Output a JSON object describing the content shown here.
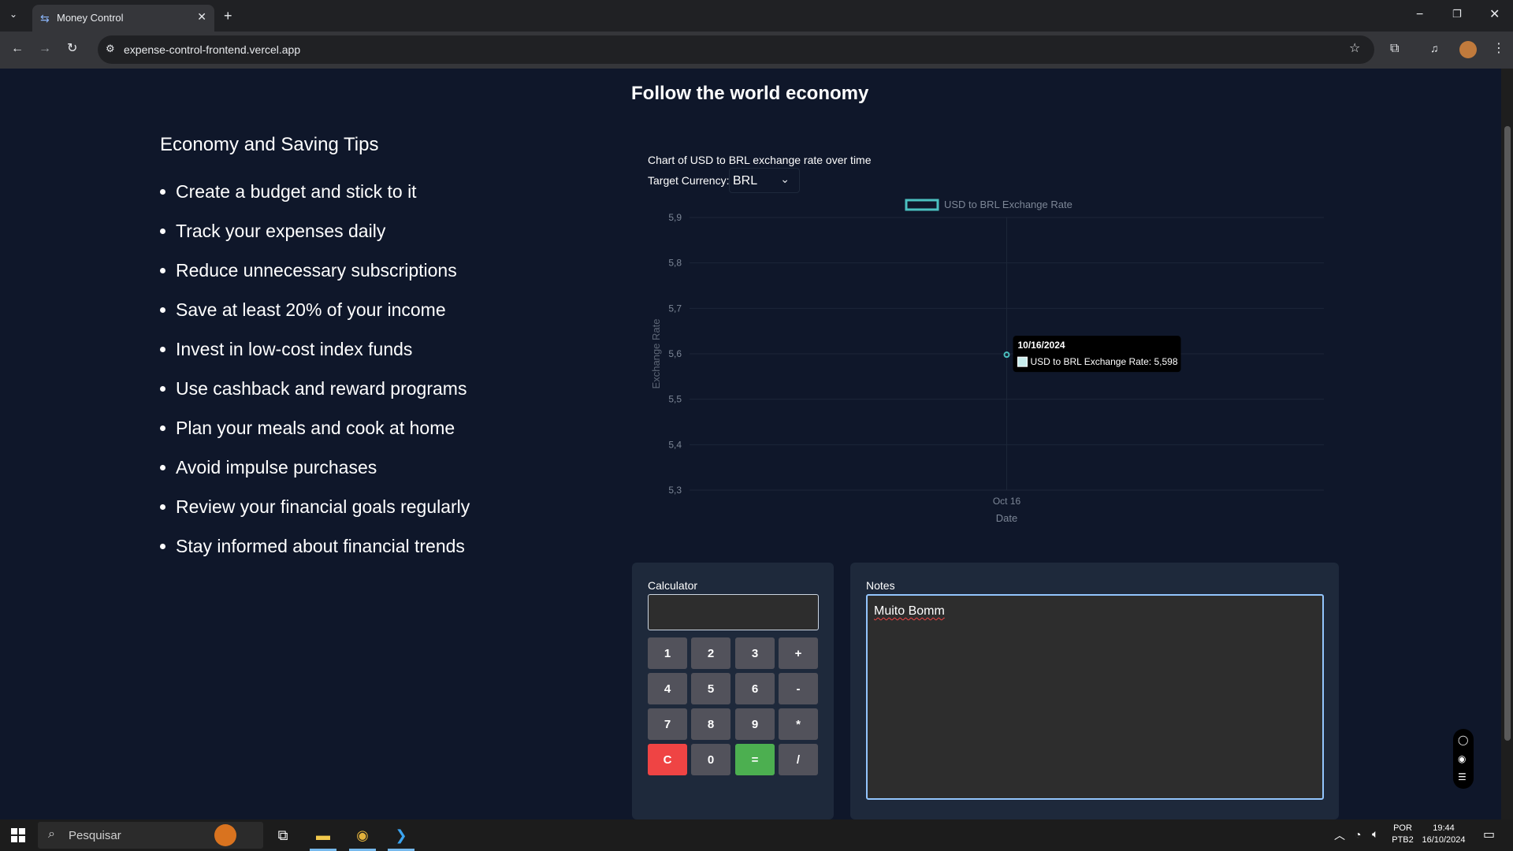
{
  "browser": {
    "tab_title": "Money Control",
    "url": "expense-control-frontend.vercel.app",
    "icons": [
      "tab-search-icon",
      "close-icon",
      "new-tab-icon",
      "minimize-icon",
      "restore-icon",
      "window-close-icon",
      "back-icon",
      "forward-icon",
      "reload-icon",
      "site-info-icon",
      "star-icon",
      "extensions-icon",
      "media-icon",
      "profile-icon",
      "menu-icon"
    ]
  },
  "page": {
    "title": "Follow the world economy",
    "tips_heading": "Economy and Saving Tips",
    "tips": [
      "Create a budget and stick to it",
      "Track your expenses daily",
      "Reduce unnecessary subscriptions",
      "Save at least 20% of your income",
      "Invest in low-cost index funds",
      "Use cashback and reward programs",
      "Plan your meals and cook at home",
      "Avoid impulse purchases",
      "Review your financial goals regularly",
      "Stay informed about financial trends"
    ]
  },
  "chart_section": {
    "title": "Chart of USD to BRL exchange rate over time",
    "target_currency_label": "Target Currency:",
    "target_currency_value": "BRL"
  },
  "chart_data": {
    "type": "line",
    "x": [
      "Oct 16"
    ],
    "series": [
      {
        "name": "USD to BRL Exchange Rate",
        "values": [
          5.598
        ]
      }
    ],
    "xlabel": "Date",
    "ylabel": "Exchange Rate",
    "ylim": [
      5.3,
      5.9
    ],
    "yticks": [
      "5,9",
      "5,8",
      "5,7",
      "5,6",
      "5,5",
      "5,4",
      "5,3"
    ],
    "xticks": [
      "Oct 16"
    ],
    "legend": "top-center",
    "series_color": "#4bc0c0",
    "tooltip": {
      "title": "10/16/2024",
      "label": "USD to BRL Exchange Rate: 5,598"
    }
  },
  "calculator": {
    "label": "Calculator",
    "display_value": "",
    "buttons": [
      "1",
      "2",
      "3",
      "+",
      "4",
      "5",
      "6",
      "-",
      "7",
      "8",
      "9",
      "*",
      "C",
      "0",
      "=",
      "/"
    ]
  },
  "notes": {
    "label": "Notes",
    "text": "Muito Bomm"
  },
  "taskbar": {
    "search_placeholder": "Pesquisar",
    "lang_top": "POR",
    "lang_bottom": "PTB2",
    "time": "19:44",
    "date": "16/10/2024"
  },
  "colors": {
    "page_bg": "#0f172a",
    "panel_bg": "#1e293b",
    "clear_btn": "#ef4444",
    "equals_btn": "#4caf50"
  }
}
